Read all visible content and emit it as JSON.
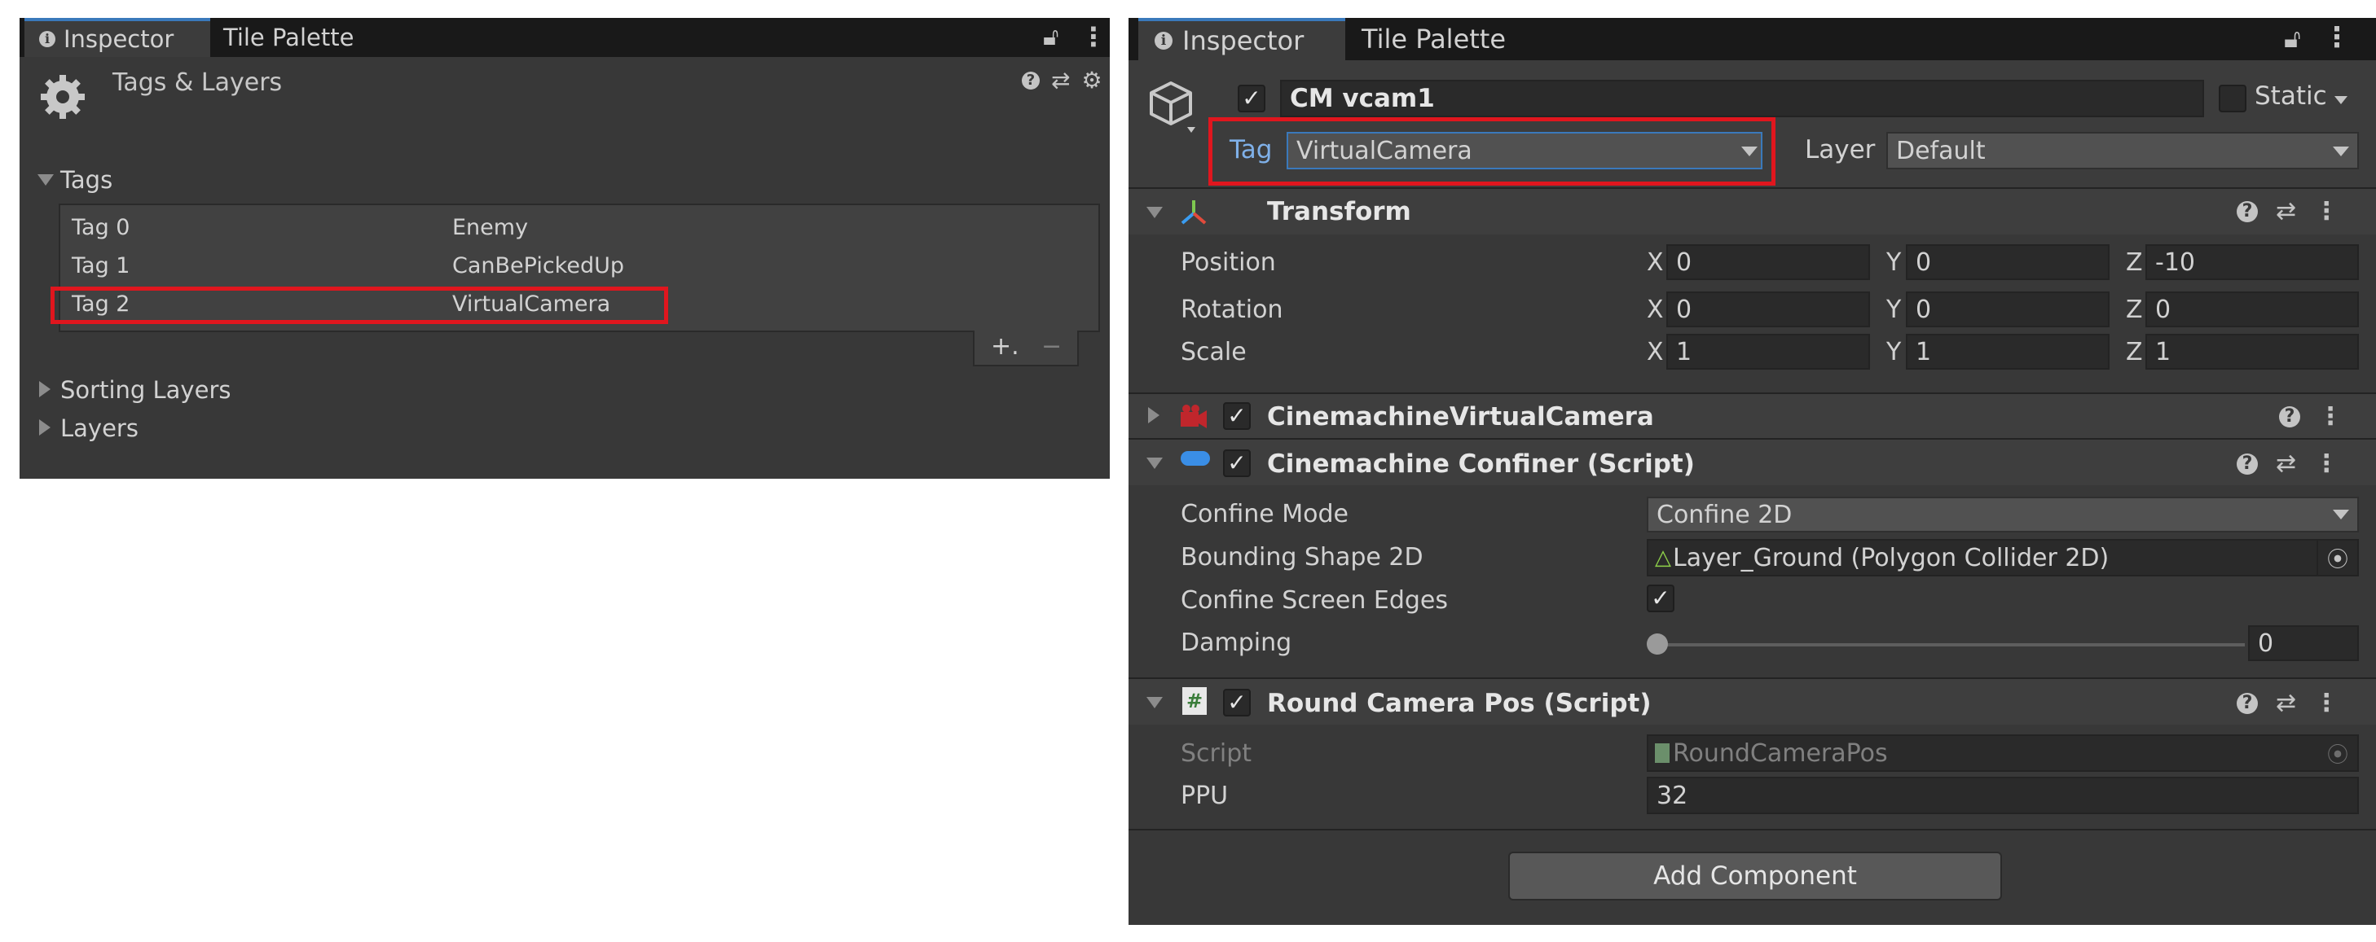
{
  "left_panel": {
    "tabs": [
      {
        "label": "Inspector"
      },
      {
        "label": "Tile Palette"
      }
    ],
    "title": "Tags & Layers",
    "tags_section": {
      "label": "Tags",
      "rows": [
        {
          "name": "Tag 0",
          "value": "Enemy"
        },
        {
          "name": "Tag 1",
          "value": "CanBePickedUp"
        },
        {
          "name": "Tag 2",
          "value": "VirtualCamera"
        }
      ],
      "add_label": "+.",
      "remove_label": "−"
    },
    "sorting_layers_label": "Sorting Layers",
    "layers_label": "Layers"
  },
  "right_panel": {
    "tabs": [
      {
        "label": "Inspector"
      },
      {
        "label": "Tile Palette"
      }
    ],
    "gameobject": {
      "name": "CM vcam1",
      "static_label": "Static",
      "tag_label": "Tag",
      "tag_value": "VirtualCamera",
      "layer_label": "Layer",
      "layer_value": "Default"
    },
    "transform": {
      "title": "Transform",
      "rows": [
        {
          "label": "Position",
          "x": "0",
          "y": "0",
          "z": "-10"
        },
        {
          "label": "Rotation",
          "x": "0",
          "y": "0",
          "z": "0"
        },
        {
          "label": "Scale",
          "x": "1",
          "y": "1",
          "z": "1"
        }
      ],
      "axis_x": "X",
      "axis_y": "Y",
      "axis_z": "Z"
    },
    "vcam_component": {
      "title": "CinemachineVirtualCamera"
    },
    "confiner": {
      "title": "Cinemachine Confiner (Script)",
      "confine_mode_label": "Confine Mode",
      "confine_mode_value": "Confine 2D",
      "bounding_label": "Bounding Shape 2D",
      "bounding_value": "Layer_Ground (Polygon Collider 2D)",
      "edges_label": "Confine Screen Edges",
      "damping_label": "Damping",
      "damping_value": "0"
    },
    "round_camera": {
      "title": "Round Camera Pos (Script)",
      "script_label": "Script",
      "script_value": "RoundCameraPos",
      "ppu_label": "PPU",
      "ppu_value": "32"
    },
    "add_component_label": "Add Component"
  },
  "colors": {
    "highlight": "#e0161e",
    "tab_accent": "#3a79bb",
    "panel_bg": "#383838"
  }
}
